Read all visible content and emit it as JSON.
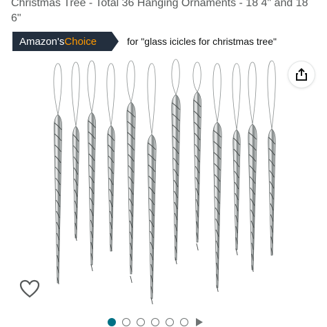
{
  "product": {
    "title_line1": "Christmas Tree - Total 36 Hanging Ornaments - 18 4\" and 18",
    "title_line2": "6\""
  },
  "badge": {
    "prefix": "Amazon's ",
    "accent": "Choice",
    "for_text": "for \"glass icicles for christmas tree\""
  },
  "colors": {
    "badge_bg": "#232f3e",
    "badge_accent": "#ff9900",
    "carousel_active": "#007185"
  },
  "icons": {
    "share": "share-icon",
    "heart": "heart-icon",
    "play": "play-icon"
  },
  "carousel": {
    "total_dots": 6,
    "active_index": 0
  }
}
